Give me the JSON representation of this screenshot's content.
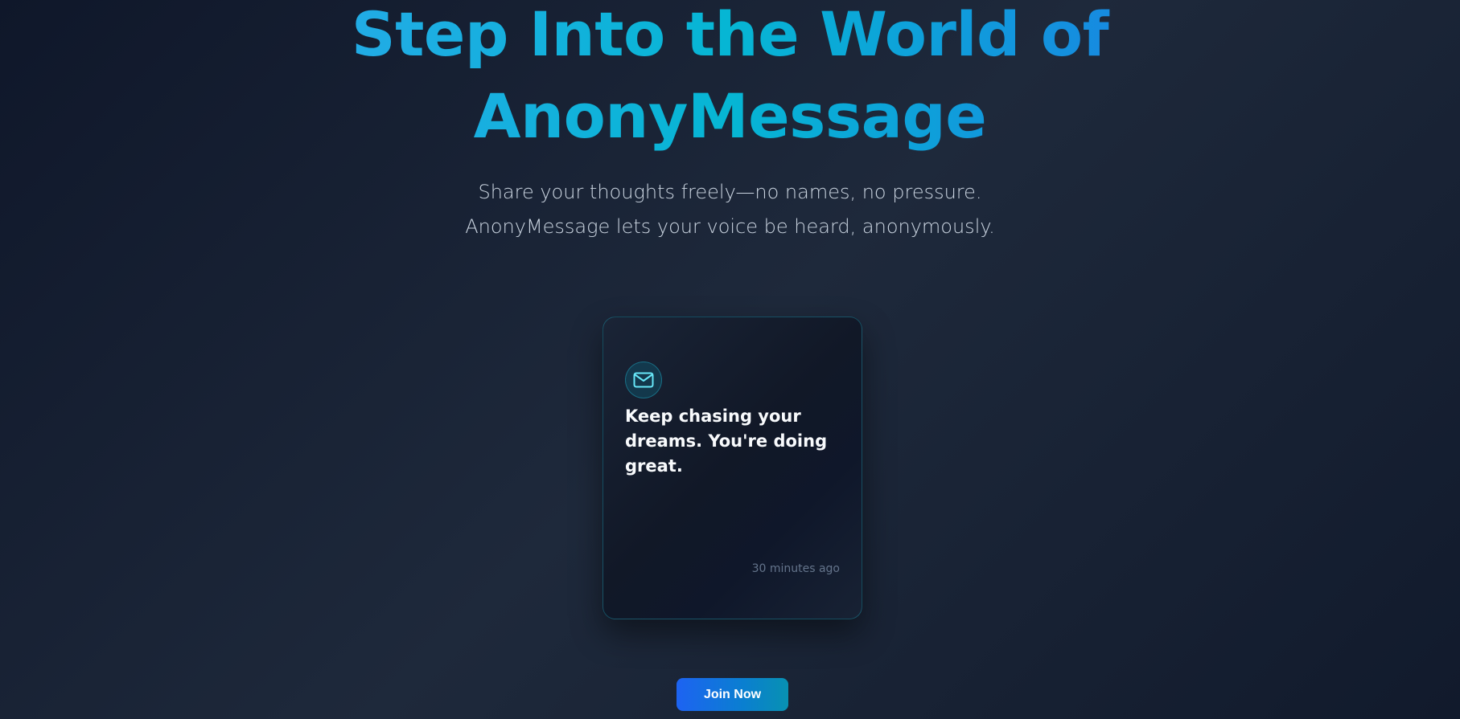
{
  "hero": {
    "title_line1": "Step Into the World of",
    "title_line2": "AnonyMessage",
    "subtitle_line1": "Share your thoughts freely—no names, no pressure.",
    "subtitle_line2": "AnonyMessage lets your voice be heard, anonymously."
  },
  "message_card": {
    "icon": "mail-icon",
    "message": "Keep chasing your dreams. You're doing great.",
    "timestamp": "30 minutes ago"
  },
  "cta": {
    "join_label": "Join Now"
  },
  "colors": {
    "background": "#0f172a",
    "accent_cyan": "#22d3ee",
    "accent_blue": "#2563eb",
    "title_gradient_start": "#3ba2f6"
  }
}
